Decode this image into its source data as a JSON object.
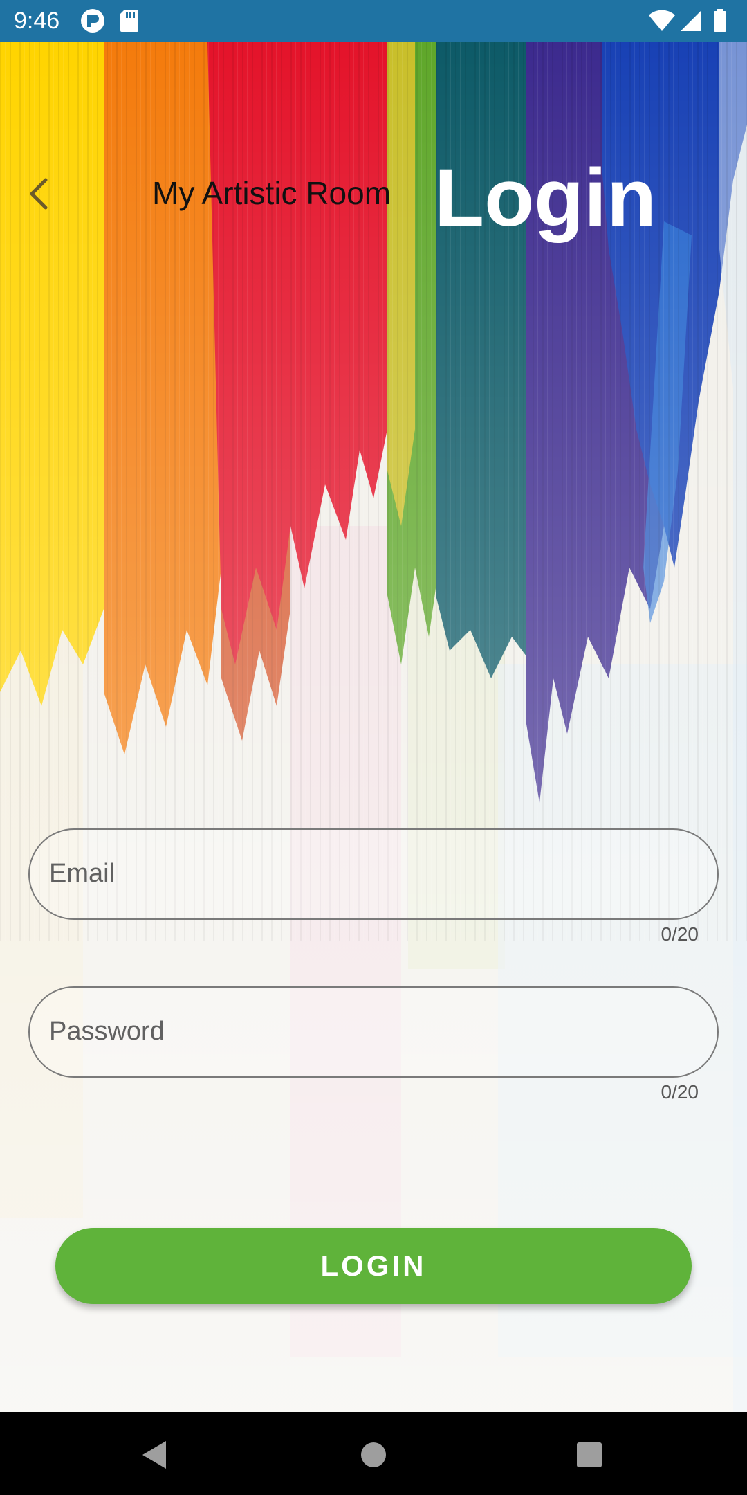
{
  "status_bar": {
    "time": "9:46",
    "icons": [
      "app-notification-icon",
      "sd-card-icon",
      "wifi-icon",
      "cellular-signal-icon",
      "battery-icon"
    ]
  },
  "app_bar": {
    "back_icon": "chevron-left-icon",
    "brand_title": "My Artistic Room",
    "heading": "Login"
  },
  "form": {
    "email": {
      "placeholder": "Email",
      "value": "",
      "counter": "0/20"
    },
    "password": {
      "placeholder": "Password",
      "value": "",
      "counter": "0/20"
    },
    "login_label": "LOGIN"
  },
  "nav_bar": {
    "icons": [
      "back-triangle-icon",
      "home-circle-icon",
      "recents-square-icon"
    ]
  },
  "colors": {
    "status_bar": "#1f73a3",
    "login_button": "#5fb33a",
    "field_border": "#7a7a7a",
    "heading_text": "#ffffff"
  }
}
